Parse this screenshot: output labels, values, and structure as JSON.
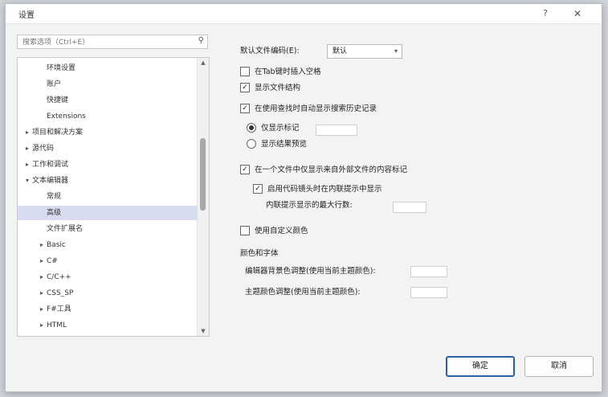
{
  "window": {
    "title": "设置",
    "help_label": "?",
    "close_label": "✕"
  },
  "search": {
    "placeholder": "搜索选项（Ctrl+E）",
    "icon": "search-icon"
  },
  "tree": {
    "items": [
      {
        "label": "环境设置",
        "level": 2,
        "expander": ""
      },
      {
        "label": "账户",
        "level": 2,
        "expander": ""
      },
      {
        "label": "快捷键",
        "level": 2,
        "expander": ""
      },
      {
        "label": "Extensions",
        "level": 2,
        "expander": ""
      },
      {
        "label": "项目和解决方案",
        "level": 1,
        "expander": "▸"
      },
      {
        "label": "源代码",
        "level": 1,
        "expander": "▸"
      },
      {
        "label": "工作和调试",
        "level": 1,
        "expander": "▸"
      },
      {
        "label": "文本编辑器",
        "level": 1,
        "expander": "▾"
      },
      {
        "label": "常规",
        "level": 2,
        "expander": ""
      },
      {
        "label": "高级",
        "level": 2,
        "expander": "",
        "selected": true
      },
      {
        "label": "文件扩展名",
        "level": 2,
        "expander": ""
      },
      {
        "label": "Basic",
        "level": 2,
        "expander": "▸"
      },
      {
        "label": "C#",
        "level": 2,
        "expander": "▸"
      },
      {
        "label": "C/C++",
        "level": 2,
        "expander": "▸"
      },
      {
        "label": "CSS_SP",
        "level": 2,
        "expander": "▸"
      },
      {
        "label": "F#工具",
        "level": 2,
        "expander": "▸"
      },
      {
        "label": "HTML",
        "level": 2,
        "expander": "▸"
      }
    ]
  },
  "right": {
    "dropdown_label": "默认文件编码(E):",
    "dropdown_value": "默认",
    "check1": "在Tab键时插入空格",
    "check2": "显示文件结构",
    "check3": "在使用查找时自动显示搜索历史记录",
    "radio1": "仅显示标记",
    "radio1_field": "",
    "radio2": "显示结果预览",
    "check4": "在一个文件中仅显示来自外部文件的内容标记",
    "sub_check": "启用代码镜头时在内联提示中显示",
    "sub_field_label": "内联提示显示的最大行数:",
    "check5": "使用自定义颜色",
    "group_title": "颜色和字体",
    "group_field1": "编辑器背景色调整(使用当前主题颜色):",
    "group_field2": "主题颜色调整(使用当前主题颜色):"
  },
  "buttons": {
    "ok": "确定",
    "cancel": "取消"
  }
}
